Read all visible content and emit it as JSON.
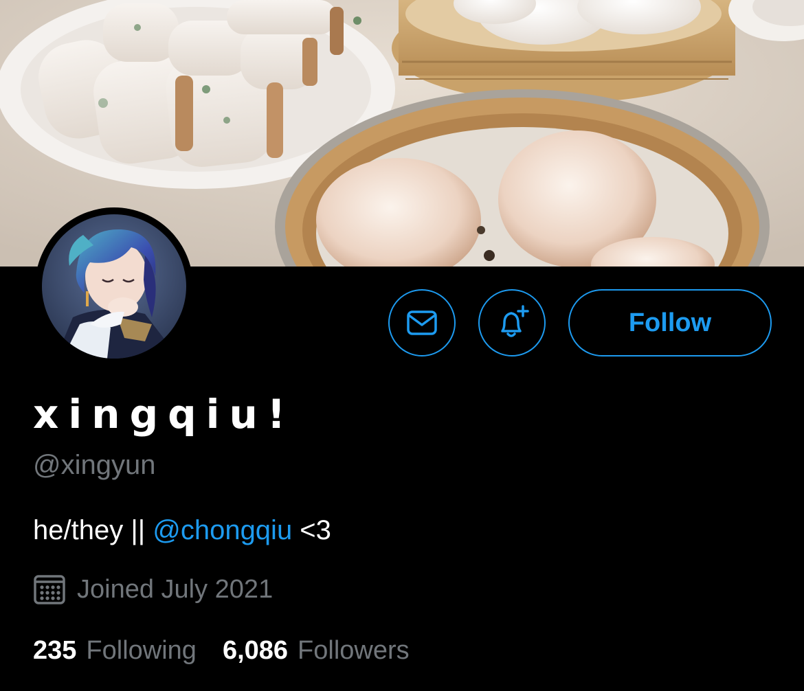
{
  "profile": {
    "display_name": "xingqiu!",
    "handle": "@xingyun",
    "bio_prefix": "he/they || ",
    "bio_mention": "@chongqiu",
    "bio_suffix": " <3",
    "joined": "Joined July 2021"
  },
  "actions": {
    "follow_label": "Follow",
    "message_icon": "envelope-icon",
    "notify_icon": "bell-plus-icon"
  },
  "stats": {
    "following_count": "235",
    "following_label": "Following",
    "followers_count": "6,086",
    "followers_label": "Followers"
  },
  "colors": {
    "accent": "#1d9bf0",
    "secondary_text": "#71767b",
    "background": "#000000"
  }
}
